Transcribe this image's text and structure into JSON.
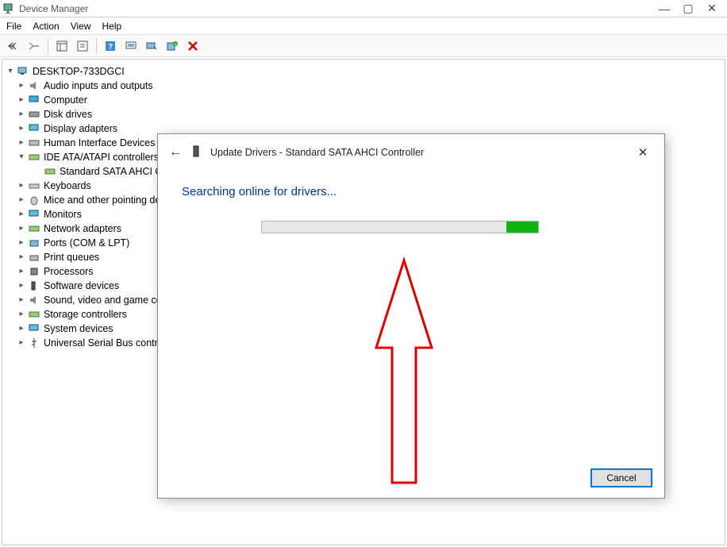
{
  "window": {
    "title": "Device Manager"
  },
  "menu": {
    "file": "File",
    "action": "Action",
    "view": "View",
    "help": "Help"
  },
  "tree": {
    "root": "DESKTOP-733DGCI",
    "items": [
      "Audio inputs and outputs",
      "Computer",
      "Disk drives",
      "Display adapters",
      "Human Interface Devices",
      "IDE ATA/ATAPI controllers",
      "Keyboards",
      "Mice and other pointing devices",
      "Monitors",
      "Network adapters",
      "Ports (COM & LPT)",
      "Print queues",
      "Processors",
      "Software devices",
      "Sound, video and game controllers",
      "Storage controllers",
      "System devices",
      "Universal Serial Bus controllers"
    ],
    "subitem": "Standard SATA AHCI Controller"
  },
  "dialog": {
    "title": "Update Drivers - Standard SATA AHCI Controller",
    "status": "Searching online for drivers...",
    "cancel": "Cancel"
  }
}
